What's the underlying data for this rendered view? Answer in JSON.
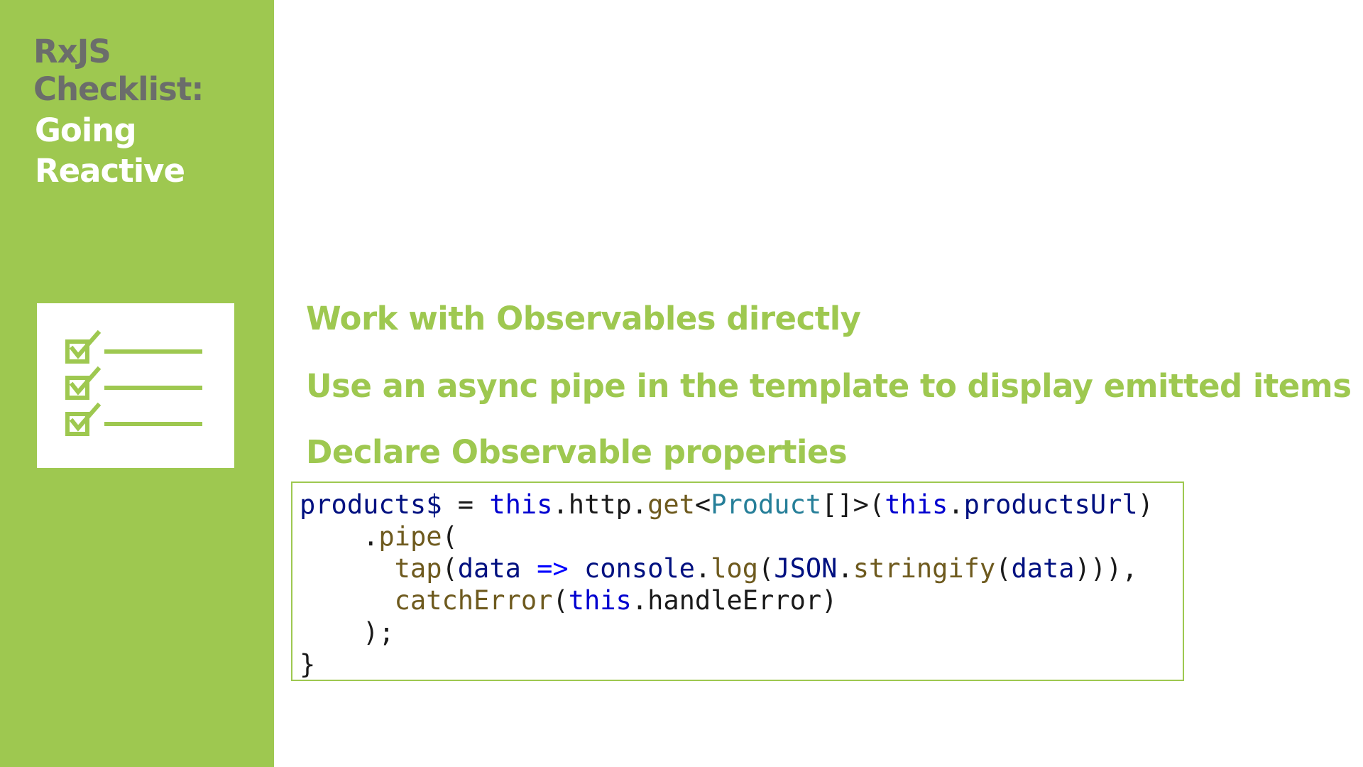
{
  "sidebar": {
    "title_line1": "RxJS",
    "title_line2": "Checklist:",
    "subtitle_line1": "Going",
    "subtitle_line2": "Reactive",
    "icon": "checklist-icon"
  },
  "main": {
    "bullets": [
      "Work with Observables directly",
      "Use an async pipe in the template to display emitted items",
      "Declare Observable properties"
    ],
    "code_lines": [
      "products$ = this.http.get<Product[]>(this.productsUrl)",
      "    .pipe(",
      "      tap(data => console.log(JSON.stringify(data))),",
      "      catchError(this.handleError)",
      "    );",
      "}"
    ]
  },
  "colors": {
    "accent_green": "#9ec850",
    "title_gray": "#6b6d6b",
    "white": "#ffffff"
  }
}
